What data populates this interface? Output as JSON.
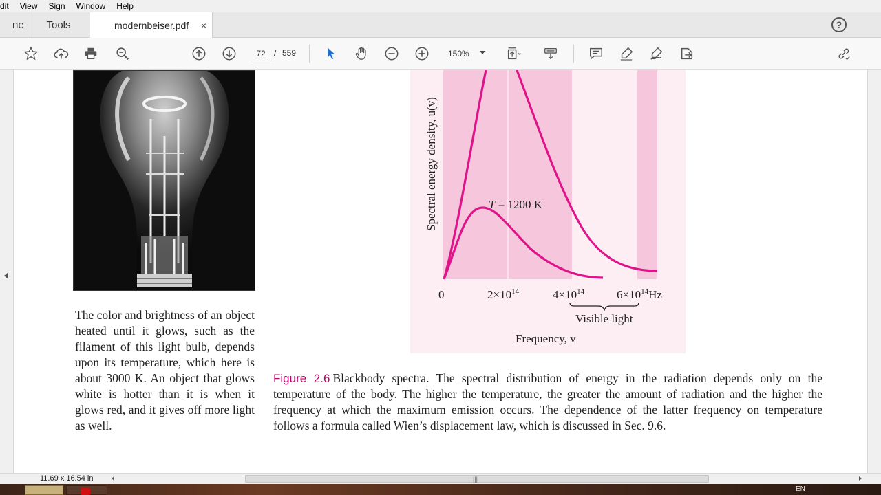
{
  "menubar": {
    "items": [
      "dit",
      "View",
      "Sign",
      "Window",
      "Help"
    ]
  },
  "tabs": {
    "home_label": "ne",
    "tools_label": "Tools",
    "doc_label": "modernbeiser.pdf",
    "close_glyph": "×"
  },
  "help": {
    "glyph": "?"
  },
  "toolbar": {
    "page_current": "72",
    "page_sep": "/",
    "page_total": "559",
    "zoom": "150%"
  },
  "left_caption": "The color and brightness of an object heated until it glows, such as the filament of this light bulb, depends upon its temperature, which here is about 3000 K. An object that glows white is hotter than it is when it glows red, and it gives off more light as well.",
  "figure": {
    "ylabel": "Spectral energy density, u(v)",
    "xlabel": "Frequency, v",
    "curve_label_T": "T",
    "curve_label_rest": " = 1200 K",
    "tick_0": "0",
    "tick_2": "2×10",
    "tick_4": "4×10",
    "tick_6": "6×10",
    "tick_exp": "14",
    "tick_unit": "Hz",
    "visible_light": "Visible light",
    "colors": {
      "curve": "#e0148a",
      "band": "#f6c6dc",
      "bg": "#fdeef4"
    }
  },
  "fig_caption": {
    "label": "Figure 2.6",
    "text": "Blackbody spectra. The spectral distribution of energy in the radiation depends only on the temperature of the body. The higher the temperature, the greater the amount of radiation and the higher the frequency at which the maximum emission occurs. The dependence of the latter frequency on temperature follows a formula called Wien’s displacement law, which is discussed in Sec. 9.6."
  },
  "status": {
    "page_size": "11.69 x 16.54 in"
  },
  "taskbar": {
    "lang": "EN"
  }
}
